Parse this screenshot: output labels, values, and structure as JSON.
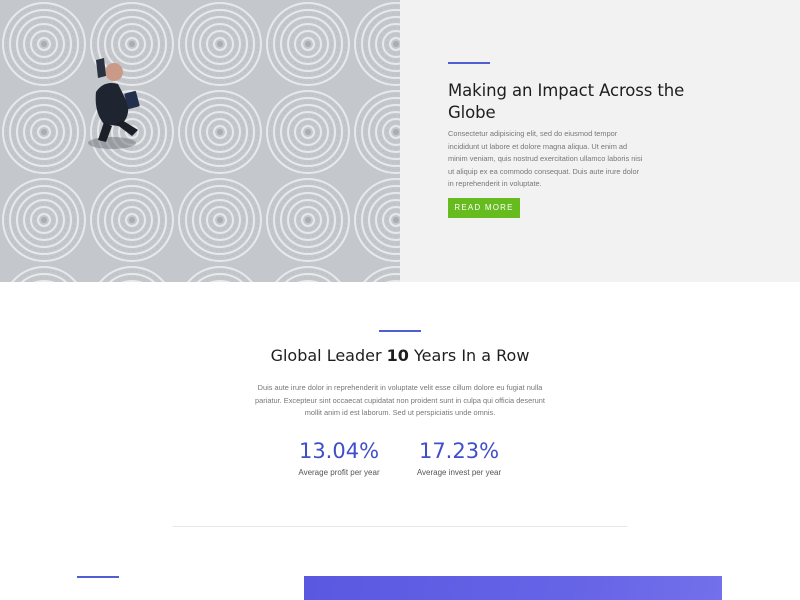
{
  "hero": {
    "title": "Making an Impact Across the Globe",
    "text": "Consectetur adipisicing elit, sed do eiusmod tempor incididunt ut labore et dolore magna aliqua. Ut enim ad minim veniam, quis nostrud exercitation ullamco laboris nisi ut aliquip ex ea commodo consequat. Duis aute irure dolor in reprehenderit in voluptate.",
    "button_label": "READ MORE",
    "image_alt": "businessman-walking-on-cobblestone-photo"
  },
  "stats": {
    "title_prefix": "Global Leader",
    "title_number": "10",
    "title_suffix": "Years In a Row",
    "text": "Duis aute irure dolor in reprehenderit in voluptate velit esse cillum dolore eu fugiat nulla pariatur. Excepteur sint occaecat cupidatat non proident sunt in culpa qui officia deserunt mollit anim id est laborum. Sed ut perspiciatis unde omnis.",
    "items": [
      {
        "value": "13.04%",
        "label": "Average profit per year"
      },
      {
        "value": "17.23%",
        "label": "Average invest per year"
      }
    ]
  },
  "colors": {
    "accent": "#4f5fd0",
    "button": "#66bb1f",
    "stat_value": "#3f4fc8",
    "panel_bg": "#f2f2f2",
    "bottom_image": "#5a58e0"
  }
}
